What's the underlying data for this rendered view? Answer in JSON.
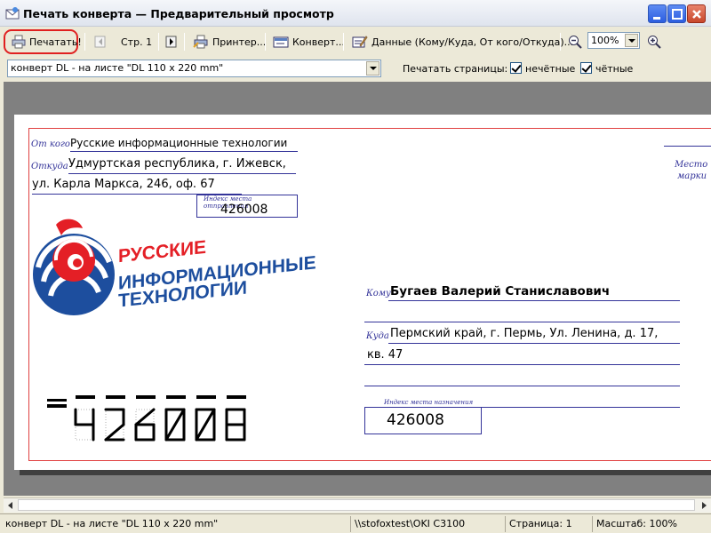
{
  "window": {
    "title": "Печать конверта — Предварительный просмотр"
  },
  "toolbar": {
    "print_label": "Печатать!",
    "page_label": "Стр. 1",
    "printer_label": "Принтер...",
    "envelope_label": "Конверт...",
    "data_label": "Данные (Кому/Куда, От кого/Откуда)...",
    "zoom_value": "100%"
  },
  "options": {
    "format_value": "конверт DL - на листе \"DL 110 x 220 mm\"",
    "print_pages_label": "Печатать страницы:",
    "odd_label": "нечётные",
    "even_label": "чётные"
  },
  "envelope": {
    "from_label": "От кого",
    "from_value": "Русские информационные технологии",
    "from_where_label": "Откуда",
    "from_where_line1": "Удмуртская республика, г. Ижевск,",
    "from_where_line2": "ул. Карла Маркса, 246, оф. 67",
    "sender_index_label": "Индекс места отправления",
    "sender_index": "426008",
    "stamp_label_1": "Место",
    "stamp_label_2": "марки",
    "to_label": "Кому",
    "to_value": "Бугаев Валерий Станиславович",
    "to_where_label": "Куда",
    "to_where_line1": "Пермский край, г. Пермь, Ул. Ленина, д. 17,",
    "to_where_line2": "кв. 47",
    "dest_index_label": "Индекс места назначения",
    "dest_index": "426008",
    "logo_line1": "РУССКИЕ",
    "logo_line2": "ИНФОРМАЦИОННЫЕ",
    "logo_line3": "ТЕХНОЛОГИИ",
    "stencil_index": "426008"
  },
  "status": {
    "format": "конверт DL - на листе \"DL 110 x 220 mm\"",
    "printer": "\\\\stofoxtest\\OKI C3100",
    "page": "Страница: 1",
    "zoom": "Масштаб: 100%"
  },
  "colors": {
    "accent_red": "#e02020",
    "envelope_blue": "#333399",
    "logo_blue": "#1d4e9e",
    "logo_red": "#e41f26"
  }
}
